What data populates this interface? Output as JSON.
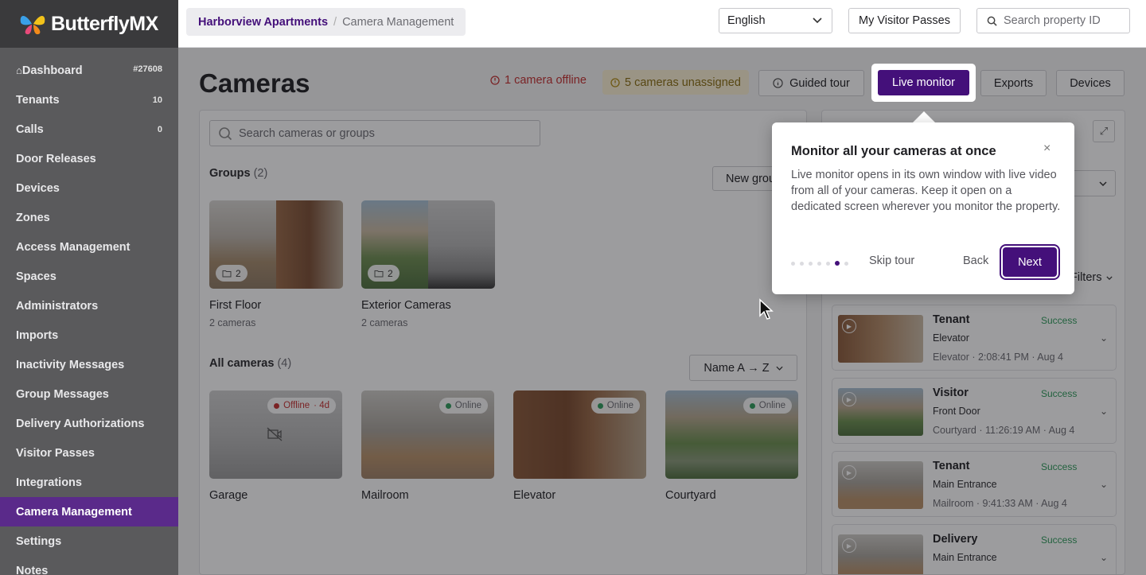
{
  "brand": {
    "name": "ButterflyMX"
  },
  "topbar": {
    "breadcrumb_property": "Harborview Apartments",
    "breadcrumb_separator": "/",
    "breadcrumb_current": "Camera Management",
    "language": "English",
    "visitor_passes": "My Visitor Passes",
    "search_placeholder": "Search property ID"
  },
  "sidebar": {
    "items": [
      {
        "label": "Dashboard",
        "count": "#27608"
      },
      {
        "label": "Tenants",
        "count": "10"
      },
      {
        "label": "Calls",
        "count": "0"
      },
      {
        "label": "Door Releases",
        "count": ""
      },
      {
        "label": "Devices",
        "count": ""
      },
      {
        "label": "Zones",
        "count": ""
      },
      {
        "label": "Access Management",
        "count": ""
      },
      {
        "label": "Spaces",
        "count": ""
      },
      {
        "label": "Administrators",
        "count": ""
      },
      {
        "label": "Imports",
        "count": ""
      },
      {
        "label": "Inactivity Messages",
        "count": ""
      },
      {
        "label": "Group Messages",
        "count": ""
      },
      {
        "label": "Delivery Authorizations",
        "count": ""
      },
      {
        "label": "Visitor Passes",
        "count": ""
      },
      {
        "label": "Integrations",
        "count": ""
      },
      {
        "label": "Camera Management",
        "count": "",
        "active": true
      },
      {
        "label": "Settings",
        "count": ""
      },
      {
        "label": "Notes",
        "count": ""
      }
    ]
  },
  "page": {
    "title": "Cameras",
    "alert_offline": "1 camera offline",
    "alert_unassigned": "5 cameras unassigned",
    "guided_tour": "Guided tour",
    "live_monitor": "Live monitor",
    "exports": "Exports",
    "devices": "Devices",
    "search_placeholder": "Search cameras or groups",
    "groups_label": "Groups",
    "groups_count": "(2)",
    "new_group": "New group",
    "all_cameras_label": "All cameras",
    "all_cameras_count": "(4)",
    "sort": "Name A → Z"
  },
  "groups": [
    {
      "name": "First Floor",
      "sub": "2 cameras",
      "count": "2"
    },
    {
      "name": "Exterior Cameras",
      "sub": "2 cameras",
      "count": "2"
    }
  ],
  "cameras": [
    {
      "name": "Garage",
      "status": "Offline",
      "age": "· 4d"
    },
    {
      "name": "Mailroom",
      "status": "Online",
      "age": ""
    },
    {
      "name": "Elevator",
      "status": "Online",
      "age": ""
    },
    {
      "name": "Courtyard",
      "status": "Online",
      "age": ""
    }
  ],
  "right_panel": {
    "label_partial": "e",
    "filters": "Filters"
  },
  "events": [
    {
      "title": "Tenant",
      "status": "Success",
      "door": "Elevator",
      "meta": "Elevator · 2:08:41 PM · Aug 4"
    },
    {
      "title": "Visitor",
      "status": "Success",
      "door": "Front Door",
      "meta": "Courtyard · 11:26:19 AM · Aug 4"
    },
    {
      "title": "Tenant",
      "status": "Success",
      "door": "Main Entrance",
      "meta": "Mailroom · 9:41:33 AM · Aug 4"
    },
    {
      "title": "Delivery",
      "status": "Success",
      "door": "Main Entrance",
      "meta": ""
    }
  ],
  "tour": {
    "title": "Monitor all your cameras at once",
    "body": "Live monitor opens in its own window with live video from all of your cameras. Keep it open on a dedicated screen wherever you monitor the property.",
    "skip": "Skip tour",
    "back": "Back",
    "next": "Next",
    "close_glyph": "×",
    "total_steps": 7,
    "current_step": 6
  },
  "colors": {
    "accent": "#44107a",
    "sidebar_bg": "#5a5a5c",
    "active_nav": "#5a2a8a",
    "offline": "#c53030",
    "online": "#2e9b5b"
  }
}
